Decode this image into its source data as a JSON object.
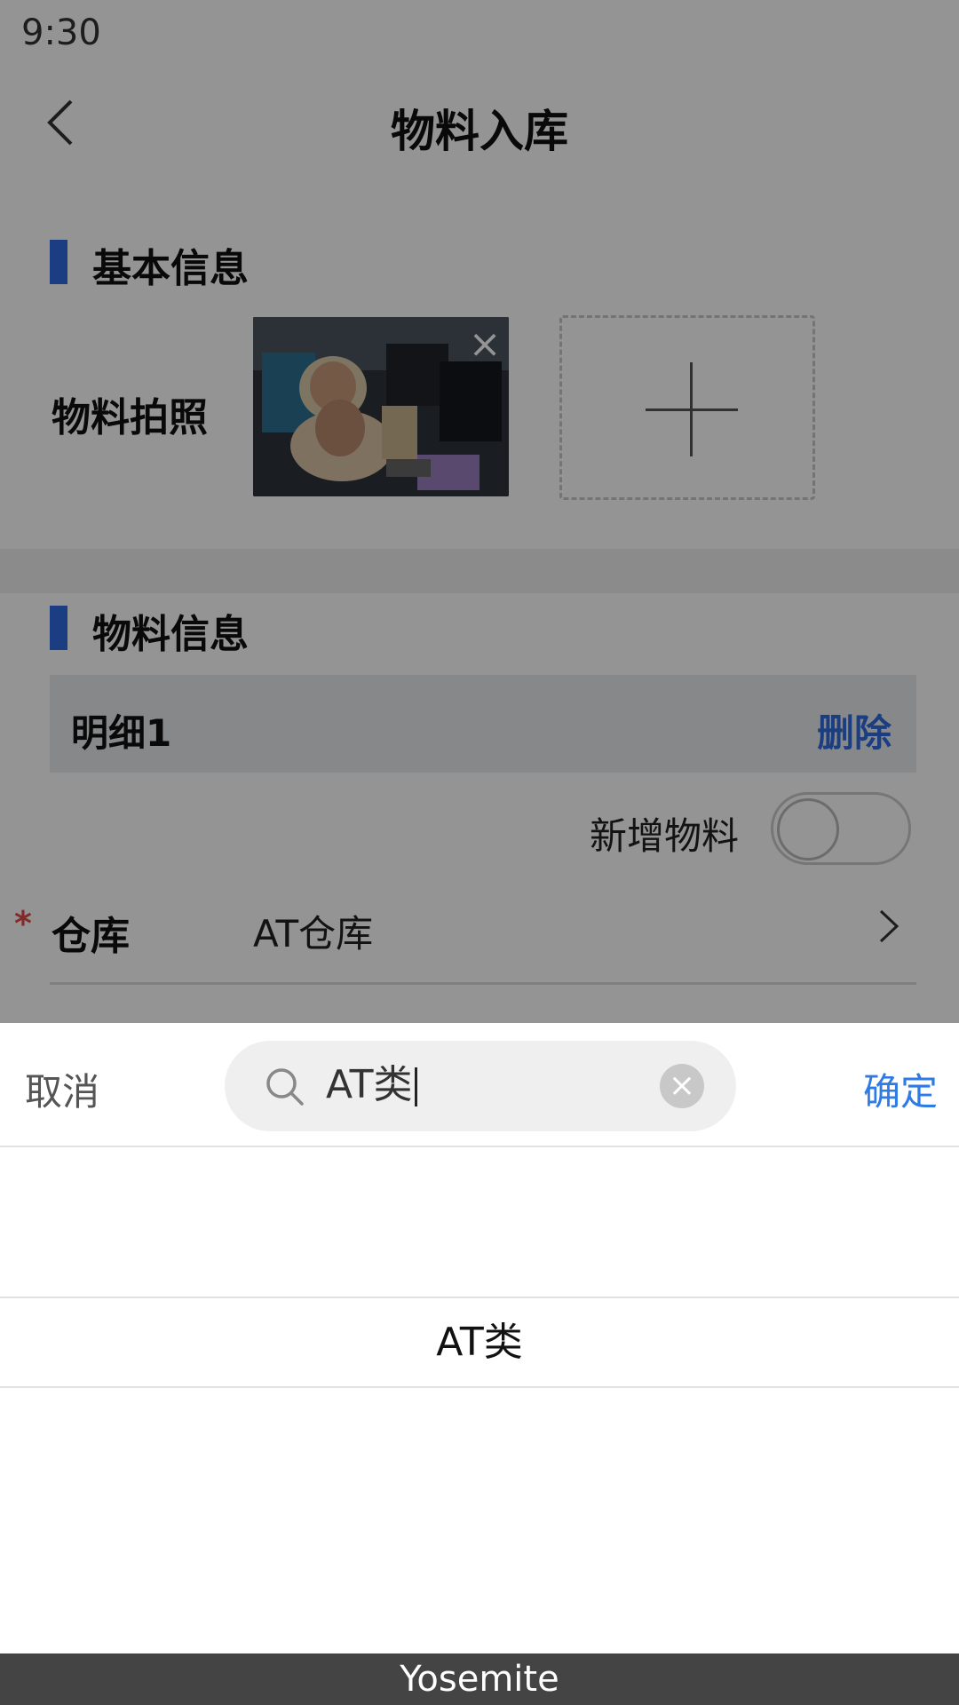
{
  "status_bar": {
    "time": "9:30"
  },
  "header": {
    "title": "物料入库"
  },
  "basic_info": {
    "section_title": "基本信息",
    "photo_label": "物料拍照"
  },
  "material_info": {
    "section_title": "物料信息",
    "detail_title": "明细1",
    "delete_label": "删除",
    "new_material_label": "新增物料",
    "new_material_toggle_on": false,
    "warehouse_label": "仓库",
    "warehouse_value": "AT仓库"
  },
  "picker": {
    "cancel_label": "取消",
    "confirm_label": "确定",
    "search_value": "AT类",
    "options": [
      "AT类"
    ]
  },
  "caption": "Yosemite",
  "colors": {
    "accent": "#2f6be0",
    "confirm": "#2f7be5",
    "required": "#e14a4a"
  }
}
